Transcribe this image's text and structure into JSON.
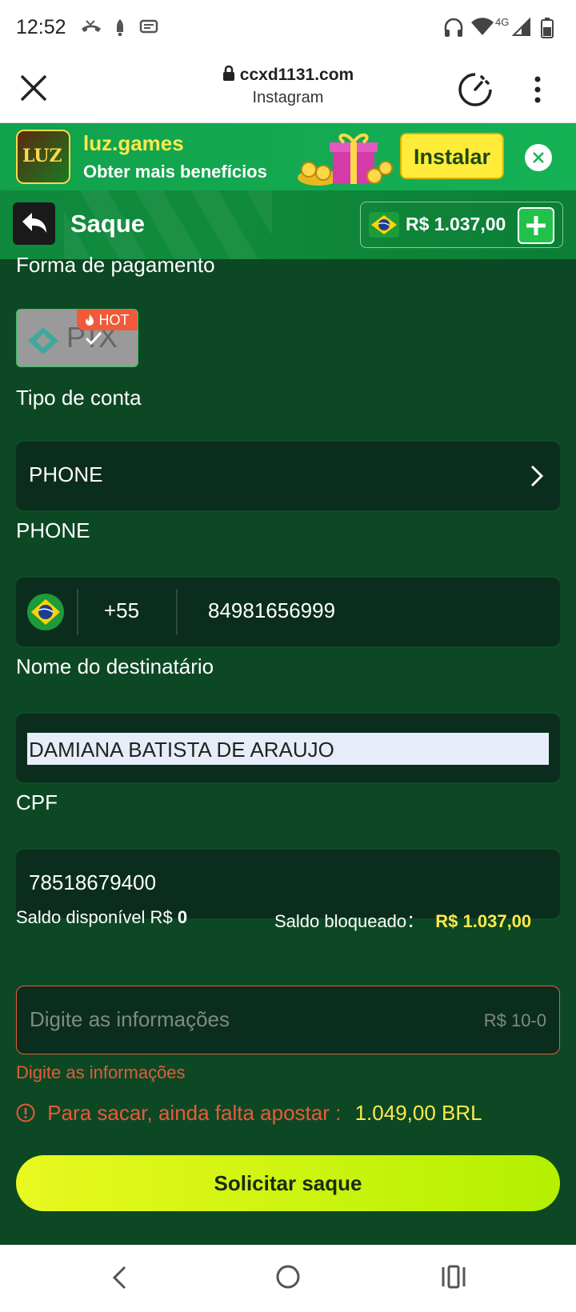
{
  "status_bar": {
    "time": "12:52",
    "network": "4G"
  },
  "browser": {
    "url": "ccxd1131.com",
    "source": "Instagram"
  },
  "install_banner": {
    "logo_text": "LUZ",
    "title": "luz.games",
    "subtitle": "Obter mais benefícios",
    "install_label": "Instalar"
  },
  "header": {
    "title": "Saque",
    "balance": "R$ 1.037,00"
  },
  "payment": {
    "label": "Forma de pagamento",
    "method": "PIX",
    "badge": "HOT"
  },
  "account_type": {
    "label": "Tipo de conta",
    "value": "PHONE"
  },
  "phone": {
    "label": "PHONE",
    "country_code": "+55",
    "number": "84981656999"
  },
  "recipient": {
    "label": "Nome do destinatário",
    "value": "DAMIANA BATISTA DE ARAUJO"
  },
  "cpf": {
    "label": "CPF",
    "value": "78518679400"
  },
  "balances": {
    "available_label": "Saldo disponível R$",
    "available_value": "0",
    "blocked_label": "Saldo bloqueado：",
    "blocked_value": "R$ 1.037,00"
  },
  "amount": {
    "placeholder": "Digite as informações",
    "range": "R$ 10-0",
    "error": "Digite as informações"
  },
  "warning": {
    "text": "Para sacar, ainda falta apostar :",
    "value": "1.049,00 BRL"
  },
  "submit_label": "Solicitar saque",
  "colors": {
    "accent_green": "#0f8a3c",
    "background": "#0d4824",
    "button": "#d8f410",
    "error": "#e85a3a",
    "highlight_yellow": "#ffe94a"
  }
}
